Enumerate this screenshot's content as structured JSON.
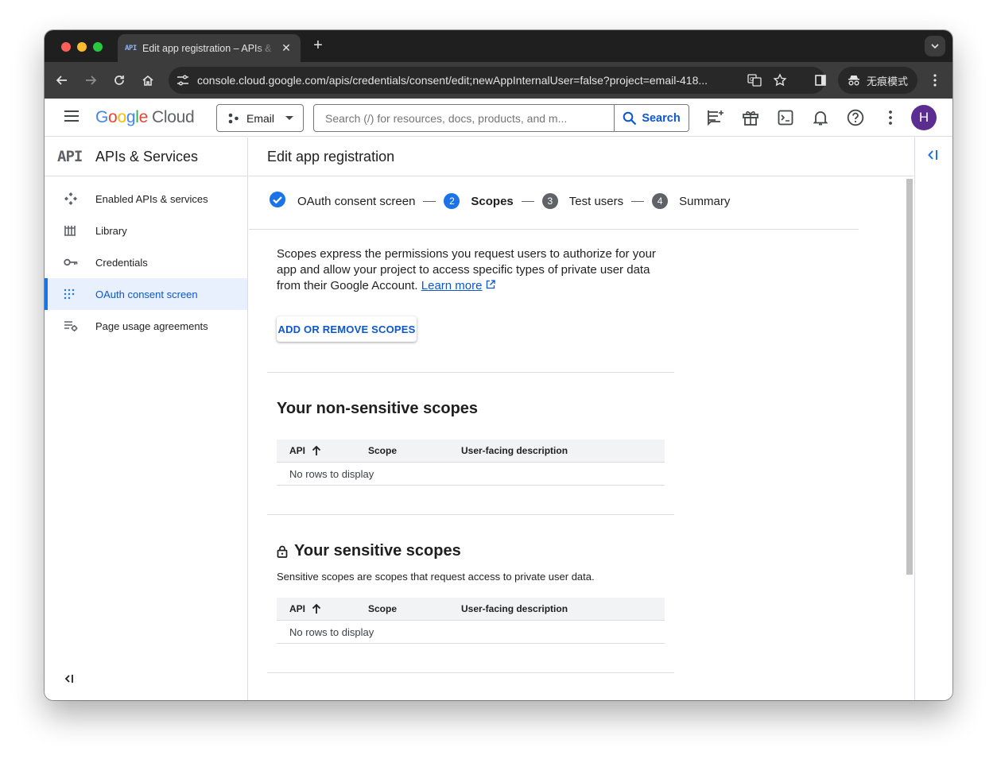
{
  "browser": {
    "tab_title": "Edit app registration – APIs & Services",
    "tab_favicon": "API",
    "url": "console.cloud.google.com/apis/credentials/consent/edit;newAppInternalUser=false?project=email-418...",
    "incognito_label": "无痕模式"
  },
  "header": {
    "logo_google": "Google",
    "logo_cloud": "Cloud",
    "project_name": "Email",
    "search_placeholder": "Search (/) for resources, docs, products, and m...",
    "search_button": "Search",
    "avatar_initial": "H"
  },
  "sidebar": {
    "logo": "API",
    "title": "APIs & Services",
    "items": [
      {
        "label": "Enabled APIs & services",
        "icon": "enabled-apis-icon"
      },
      {
        "label": "Library",
        "icon": "library-icon"
      },
      {
        "label": "Credentials",
        "icon": "key-icon"
      },
      {
        "label": "OAuth consent screen",
        "icon": "consent-icon",
        "active": true
      },
      {
        "label": "Page usage agreements",
        "icon": "agreements-icon"
      }
    ]
  },
  "main": {
    "title": "Edit app registration",
    "steps": [
      {
        "num": "",
        "label": "OAuth consent screen",
        "state": "done"
      },
      {
        "num": "2",
        "label": "Scopes",
        "state": "active"
      },
      {
        "num": "3",
        "label": "Test users",
        "state": "inactive"
      },
      {
        "num": "4",
        "label": "Summary",
        "state": "inactive"
      }
    ],
    "description": "Scopes express the permissions you request users to authorize for your app and allow your project to access specific types of private user data from their Google Account.",
    "learn_more": "Learn more",
    "add_button": "ADD OR REMOVE SCOPES",
    "non_sensitive": {
      "title": "Your non-sensitive scopes",
      "columns": [
        "API",
        "Scope",
        "User-facing description"
      ],
      "empty": "No rows to display"
    },
    "sensitive": {
      "title": "Your sensitive scopes",
      "description": "Sensitive scopes are scopes that request access to private user data.",
      "columns": [
        "API",
        "Scope",
        "User-facing description"
      ],
      "empty": "No rows to display"
    }
  },
  "colors": {
    "accent": "#0b57d0",
    "step_active": "#1a73e8",
    "step_inactive": "#5f6368",
    "avatar": "#5c2d91"
  }
}
